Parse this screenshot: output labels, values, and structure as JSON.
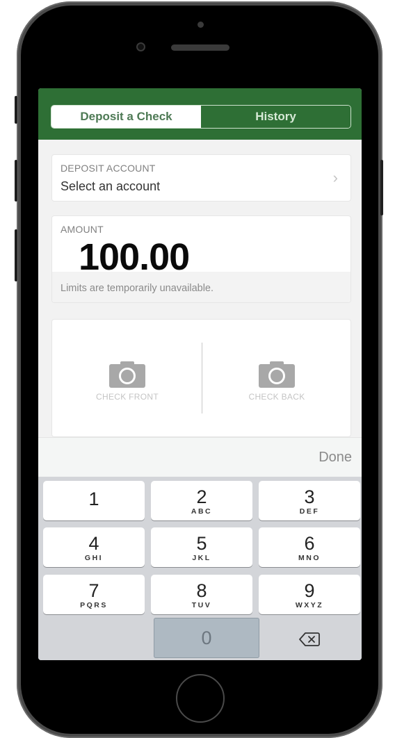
{
  "header": {
    "tabs": [
      {
        "label": "Deposit a Check",
        "active": true
      },
      {
        "label": "History",
        "active": false
      }
    ]
  },
  "deposit_account": {
    "label": "DEPOSIT ACCOUNT",
    "value": "Select an account",
    "icon": "chevron-right-icon"
  },
  "amount": {
    "label": "AMOUNT",
    "value": "100.00",
    "limits_note": "Limits are temporarily unavailable."
  },
  "check_capture": {
    "front_label": "CHECK FRONT",
    "back_label": "CHECK BACK",
    "icon": "camera-icon"
  },
  "keyboard_toolbar": {
    "done_label": "Done"
  },
  "keypad": {
    "keys": [
      {
        "num": "1",
        "letters": ""
      },
      {
        "num": "2",
        "letters": "ABC"
      },
      {
        "num": "3",
        "letters": "DEF"
      },
      {
        "num": "4",
        "letters": "GHI"
      },
      {
        "num": "5",
        "letters": "JKL"
      },
      {
        "num": "6",
        "letters": "MNO"
      },
      {
        "num": "7",
        "letters": "PQRS"
      },
      {
        "num": "8",
        "letters": "TUV"
      },
      {
        "num": "9",
        "letters": "WXYZ"
      },
      {
        "num": "0",
        "letters": ""
      }
    ],
    "delete_icon": "backspace-icon"
  },
  "colors": {
    "brand_green": "#2e6f35",
    "keyboard_bg": "#d3d5d9",
    "zero_key_pressed": "#aeb9c2"
  }
}
